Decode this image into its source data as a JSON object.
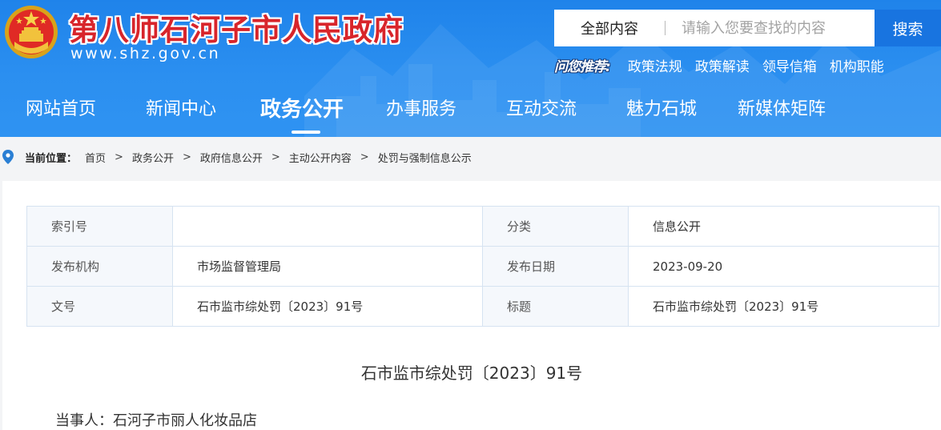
{
  "header": {
    "site_title": "第八师石河子市人民政府",
    "site_url": "www.shz.gov.cn",
    "search": {
      "scope": "全部内容",
      "placeholder": "请输入您要查找的内容",
      "button": "搜索"
    },
    "hot": {
      "label": "问您推荐:",
      "links": [
        "政策法规",
        "政策解读",
        "领导信箱",
        "机构职能"
      ]
    },
    "nav": [
      {
        "label": "网站首页",
        "active": false
      },
      {
        "label": "新闻中心",
        "active": false
      },
      {
        "label": "政务公开",
        "active": true
      },
      {
        "label": "办事服务",
        "active": false
      },
      {
        "label": "互动交流",
        "active": false
      },
      {
        "label": "魅力石城",
        "active": false
      },
      {
        "label": "新媒体矩阵",
        "active": false
      }
    ]
  },
  "breadcrumb": {
    "label": "当前位置：",
    "items": [
      "首页",
      "政务公开",
      "政府信息公开",
      "主动公开内容",
      "处罚与强制信息公示"
    ]
  },
  "meta_table": {
    "rows": [
      [
        {
          "key": "索引号",
          "value": ""
        },
        {
          "key": "分类",
          "value": "信息公开"
        }
      ],
      [
        {
          "key": "发布机构",
          "value": "市场监督管理局"
        },
        {
          "key": "发布日期",
          "value": "2023-09-20"
        }
      ],
      [
        {
          "key": "文号",
          "value": "石市监市综处罚〔2023〕91号"
        },
        {
          "key": "标题",
          "value": "石市监市综处罚〔2023〕91号"
        }
      ]
    ]
  },
  "article": {
    "title": "石市监市综处罚〔2023〕91号",
    "party": "当事人：石河子市丽人化妆品店"
  },
  "colors": {
    "header_blue": "#2b8ff0",
    "search_button": "#1874e0",
    "title_red": "#d8252b",
    "table_border": "#d6e3f1"
  }
}
